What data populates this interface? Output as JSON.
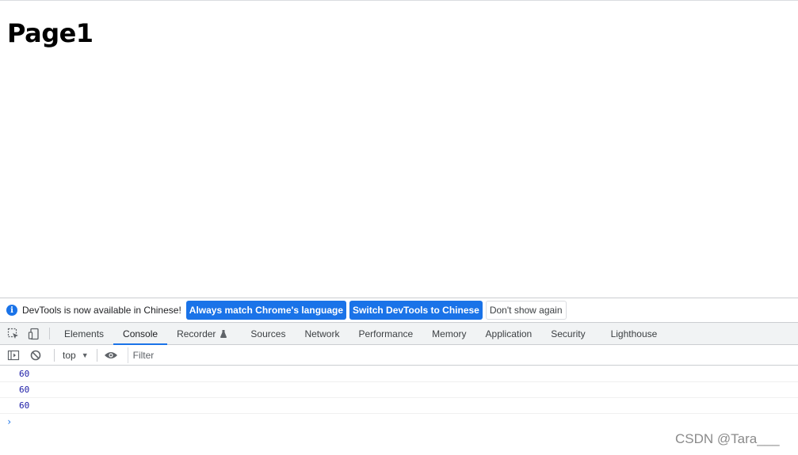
{
  "page": {
    "title": "Page1"
  },
  "infobar": {
    "message": "DevTools is now available in Chinese!",
    "btn_match_language": "Always match Chrome's language",
    "btn_switch_language": "Switch DevTools to Chinese",
    "btn_dont_show": "Don't show again",
    "icon": "info-icon"
  },
  "tabs": [
    {
      "label": "Elements"
    },
    {
      "label": "Console",
      "active": true
    },
    {
      "label": "Recorder"
    },
    {
      "label": "Sources"
    },
    {
      "label": "Network"
    },
    {
      "label": "Performance"
    },
    {
      "label": "Memory"
    },
    {
      "label": "Application"
    },
    {
      "label": "Security"
    },
    {
      "label": "Lighthouse"
    }
  ],
  "toolbar": {
    "context": "top",
    "filter_placeholder": "Filter"
  },
  "console": {
    "messages": [
      "60",
      "60",
      "60"
    ],
    "prompt": "›"
  },
  "watermark": "CSDN @Tara___",
  "colors": {
    "accent": "#1a73e8",
    "number": "#1a1aa6"
  }
}
